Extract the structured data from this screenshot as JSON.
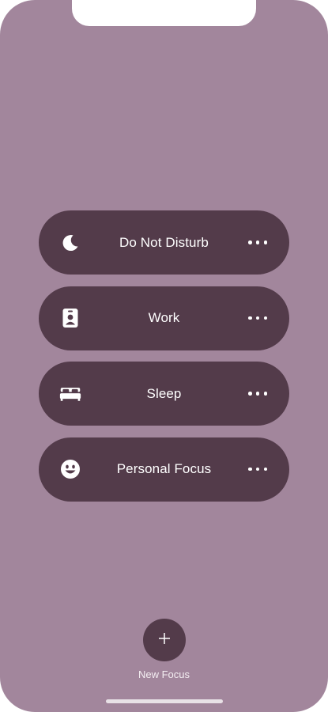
{
  "focus_modes": [
    {
      "label": "Do Not Disturb",
      "icon": "moon-icon"
    },
    {
      "label": "Work",
      "icon": "id-badge-icon"
    },
    {
      "label": "Sleep",
      "icon": "bed-icon"
    },
    {
      "label": "Personal Focus",
      "icon": "smiley-icon"
    }
  ],
  "new_focus": {
    "label": "New Focus",
    "icon": "plus-icon"
  },
  "colors": {
    "background": "#a2869c",
    "pill": "#533b4a",
    "text": "#ffffff"
  }
}
